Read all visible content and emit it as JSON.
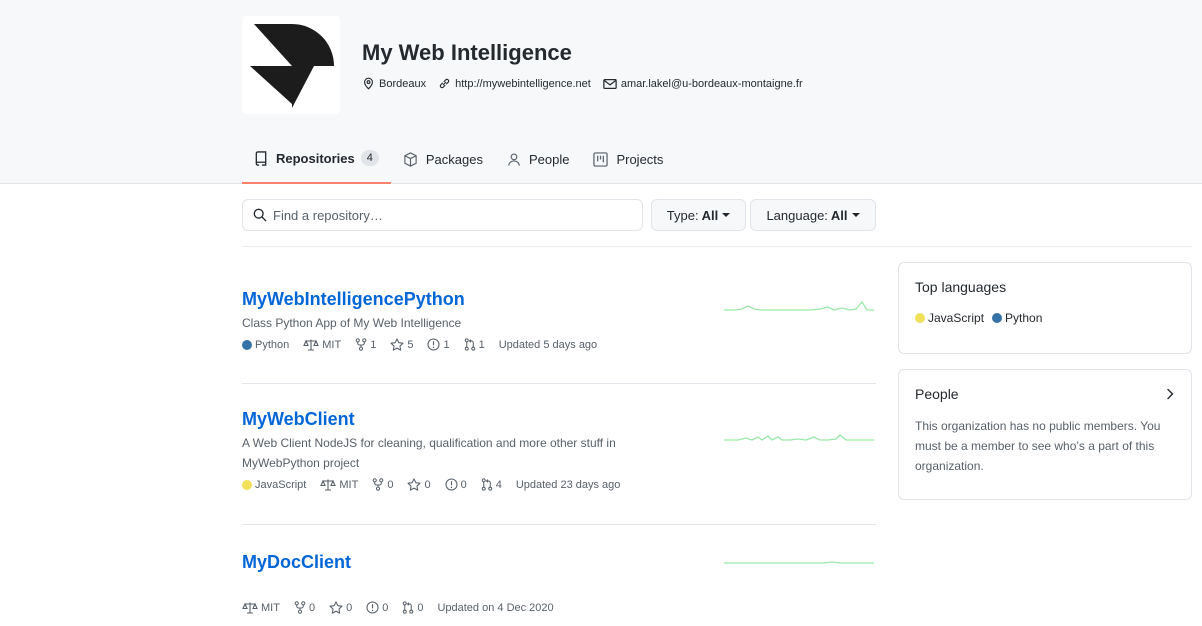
{
  "org": {
    "name": "My Web Intelligence",
    "location": "Bordeaux",
    "website": "http://mywebintelligence.net",
    "email": "amar.lakel@u-bordeaux-montaigne.fr"
  },
  "tabs": [
    {
      "label": "Repositories",
      "count": "4",
      "active": true,
      "icon": "repo-icon"
    },
    {
      "label": "Packages",
      "icon": "package-icon"
    },
    {
      "label": "People",
      "icon": "person-icon"
    },
    {
      "label": "Projects",
      "icon": "project-icon"
    }
  ],
  "search": {
    "placeholder": "Find a repository…"
  },
  "filters": {
    "type_label": "Type:",
    "type_value": "All",
    "language_label": "Language:",
    "language_value": "All"
  },
  "repos": [
    {
      "name": "MyWebIntelligencePython",
      "description": "Class Python App of My Web Intelligence",
      "language": "Python",
      "language_color": "#3572A5",
      "license": "MIT",
      "forks": "1",
      "stars": "5",
      "issues": "1",
      "prs": "1",
      "updated": "Updated 5 days ago"
    },
    {
      "name": "MyWebClient",
      "description": "A Web Client NodeJS for cleaning, qualification and more other stuff in MyWebPython project",
      "language": "JavaScript",
      "language_color": "#f1e05a",
      "license": "MIT",
      "forks": "0",
      "stars": "0",
      "issues": "0",
      "prs": "4",
      "updated": "Updated 23 days ago"
    },
    {
      "name": "MyDocClient",
      "description": "",
      "license": "MIT",
      "forks": "0",
      "stars": "0",
      "issues": "0",
      "prs": "0",
      "updated": "Updated on 4 Dec 2020"
    }
  ],
  "sidebar": {
    "top_languages": {
      "title": "Top languages",
      "items": [
        {
          "name": "JavaScript",
          "color": "#f1e05a"
        },
        {
          "name": "Python",
          "color": "#3572A5"
        }
      ]
    },
    "people": {
      "title": "People",
      "text": "This organization has no public members. You must be a member to see who’s a part of this organization."
    }
  },
  "colors": {
    "accent": "#0366d6",
    "tab_underline": "#f9826c",
    "sparkline": "#9be9a8"
  }
}
